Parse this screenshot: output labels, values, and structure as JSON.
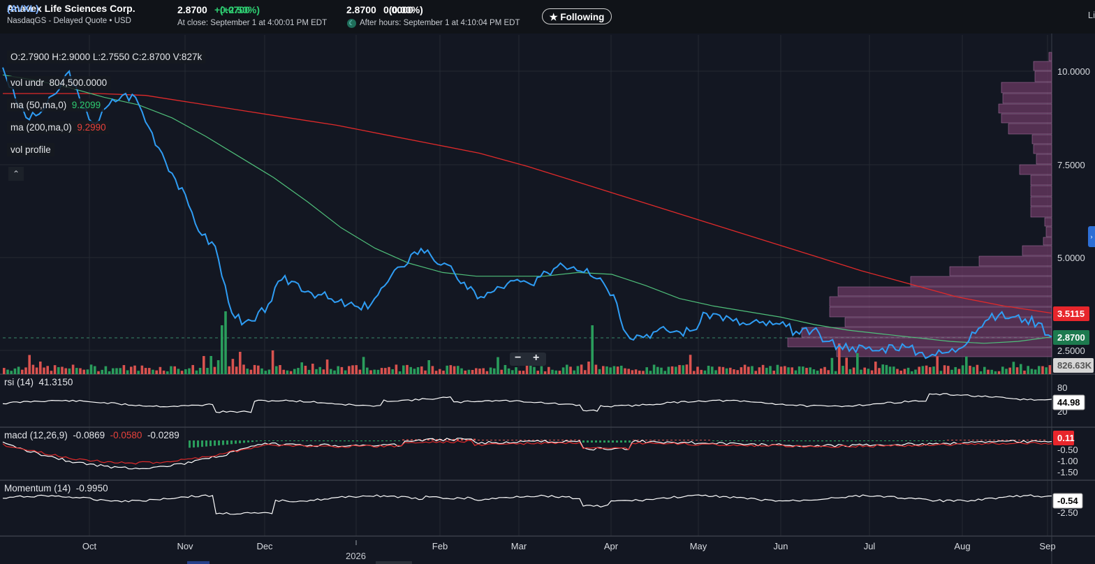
{
  "header": {
    "company": "Anavex Life Sciences Corp.",
    "ticker": "(AVXL)",
    "exchange": "NasdaqGS - Delayed Quote • USD",
    "close_price": "2.8700",
    "close_change": "+0.0700",
    "close_change_pct": "(+2.50%)",
    "close_time": "At close: September 1 at 4:00:01 PM EDT",
    "after_price": "2.8700",
    "after_change": "0.0000",
    "after_change_pct": "(0.00%)",
    "after_time": "After hours: September 1 at 4:10:04 PM EDT",
    "follow_label": "★ Following",
    "right_cut": "Li"
  },
  "legend": {
    "ohlcv": "O:2.7900   H:2.9000   L:2.7550   C:2.8700   V:827k",
    "vol_undr_label": "vol undr",
    "vol_undr_value": "804,500.0000",
    "ma50_label": "ma (50,ma,0)",
    "ma50_value": "9.2099",
    "ma200_label": "ma (200,ma,0)",
    "ma200_value": "9.2990",
    "vol_profile_label": "vol profile",
    "collapse_icon": "chevron-up-icon"
  },
  "panels": {
    "rsi": {
      "label": "rsi (14)",
      "value": "41.3150",
      "badge": "44.98",
      "ticks": [
        "80",
        "20"
      ]
    },
    "macd": {
      "label": "macd (12,26,9)",
      "macd": "-0.0869",
      "signal": "-0.0580",
      "hist": "-0.0289",
      "badge": "0.11",
      "ticks": [
        "-0.50",
        "-1.00",
        "-1.50"
      ]
    },
    "momentum": {
      "label": "Momentum (14)",
      "value": "-0.9950",
      "badge": "-0.54",
      "ticks": [
        "-2.50"
      ]
    }
  },
  "colors": {
    "up": "#2a9d5c",
    "down": "#d9534f",
    "price_line": "#2f9df4",
    "ma50": "#4fbf7a",
    "ma200": "#e02a2a",
    "vol_profile": "#6b3a63",
    "badge_red": "#e8262c",
    "badge_green": "#1d7a4f"
  },
  "chart_data": {
    "type": "line",
    "title": "",
    "x_labels": [
      "Oct",
      "Nov",
      "Dec",
      "2026",
      "Feb",
      "Mar",
      "Apr",
      "May",
      "Jun",
      "Jul",
      "Aug",
      "Sep"
    ],
    "price_axis": [
      "10.0000",
      "7.5000",
      "5.0000",
      "2.5000"
    ],
    "price_badges": {
      "ma200": "3.5115",
      "last": "2.8700",
      "volume": "826.63K"
    },
    "ylim": [
      2.0,
      10.8
    ],
    "series": [
      {
        "name": "price",
        "values": [
          10.1,
          9.2,
          8.7,
          8.95,
          9.4,
          10.0,
          9.0,
          8.6,
          9.1,
          9.35,
          9.3,
          8.5,
          7.8,
          7.1,
          6.4,
          5.6,
          5.3,
          3.8,
          3.2,
          3.3,
          3.75,
          4.4,
          4.35,
          4.1,
          4.0,
          3.8,
          3.75,
          3.6,
          3.9,
          4.35,
          4.75,
          5.15,
          5.2,
          4.8,
          4.6,
          4.15,
          3.95,
          4.1,
          4.3,
          4.35,
          4.25,
          4.6,
          4.85,
          4.75,
          4.7,
          4.45,
          4.0,
          2.95,
          2.9,
          3.0,
          3.05,
          3.0,
          3.05,
          3.5,
          3.45,
          3.3,
          3.2,
          3.25,
          3.2,
          3.15,
          2.95,
          3.05,
          2.75,
          2.65,
          2.6,
          2.55,
          2.5,
          2.65,
          2.6,
          2.45,
          2.4,
          2.45,
          2.55,
          3.0,
          3.3,
          3.45,
          3.4,
          3.35,
          3.25,
          2.87
        ]
      },
      {
        "name": "ma (50,ma,0)",
        "values": [
          9.9,
          9.75,
          9.55,
          9.3,
          9.1,
          8.75,
          8.25,
          7.7,
          7.15,
          6.5,
          5.8,
          5.25,
          4.85,
          4.6,
          4.5,
          4.5,
          4.5,
          4.6,
          4.55,
          4.25,
          3.9,
          3.7,
          3.55,
          3.4,
          3.2,
          3.05,
          2.95,
          2.85,
          2.75,
          2.7,
          2.75,
          2.87
        ]
      },
      {
        "name": "ma (200,ma,0)",
        "values": [
          9.4,
          9.4,
          9.4,
          9.35,
          9.15,
          8.95,
          8.75,
          8.55,
          8.3,
          8.05,
          7.8,
          7.45,
          7.05,
          6.65,
          6.25,
          5.85,
          5.45,
          5.05,
          4.65,
          4.3,
          3.95,
          3.7,
          3.51
        ]
      }
    ]
  }
}
